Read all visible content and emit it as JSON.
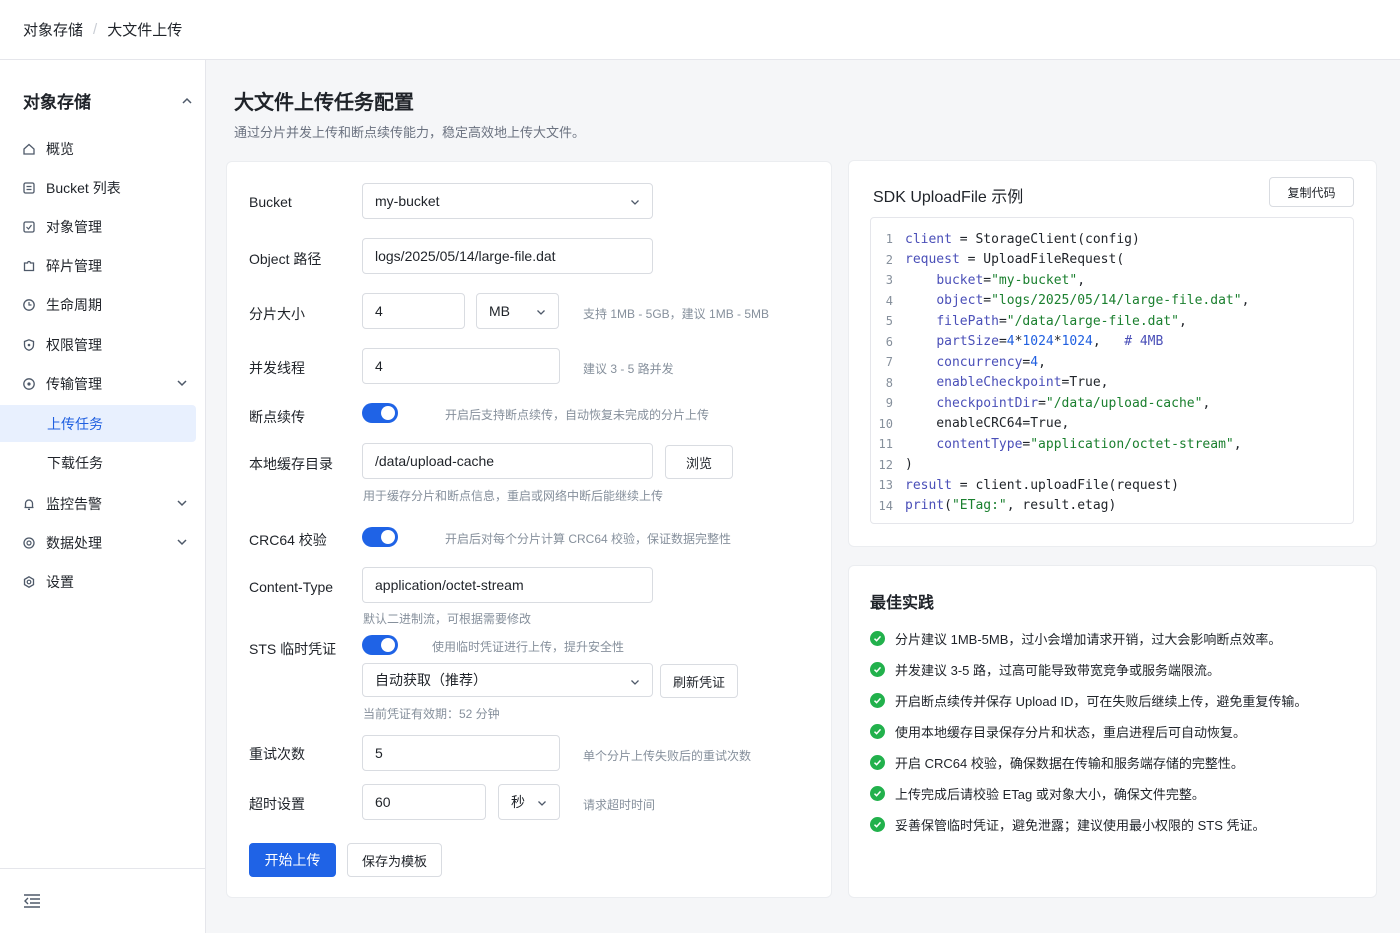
{
  "breadcrumb": {
    "root": "对象存储",
    "current": "大文件上传"
  },
  "sidebar": {
    "header": "对象存储",
    "items": [
      {
        "label": "概览",
        "icon": "home-icon"
      },
      {
        "label": "Bucket 列表",
        "icon": "list-icon"
      },
      {
        "label": "对象管理",
        "icon": "file-icon"
      },
      {
        "label": "碎片管理",
        "icon": "puzzle-icon"
      },
      {
        "label": "生命周期",
        "icon": "clock-icon"
      },
      {
        "label": "权限管理",
        "icon": "shield-icon"
      },
      {
        "label": "传输管理",
        "icon": "transfer-icon"
      },
      {
        "label": "上传任务"
      },
      {
        "label": "下载任务"
      },
      {
        "label": "监控告警",
        "icon": "bell-icon"
      },
      {
        "label": "数据处理",
        "icon": "gear-icon"
      },
      {
        "label": "设置",
        "icon": "settings-icon"
      }
    ]
  },
  "page": {
    "title": "大文件上传任务配置",
    "description": "通过分片并发上传和断点续传能力，稳定高效地上传大文件。"
  },
  "form": {
    "bucket_label": "Bucket",
    "bucket_value": "my-bucket",
    "path_label": "Object 路径",
    "path_value": "logs/2025/05/14/large-file.dat",
    "part_label": "分片大小",
    "part_value": "4",
    "part_unit": "MB",
    "part_hint": "支持 1MB - 5GB，建议 1MB - 5MB",
    "threads_label": "并发线程",
    "threads_value": "4",
    "threads_hint": "建议 3 - 5 路并发",
    "resume_label": "断点续传",
    "resume_hint": "开启后支持断点续传，自动恢复未完成的分片上传",
    "cache_label": "本地缓存目录",
    "cache_value": "/data/upload-cache",
    "browse_button": "浏览",
    "cache_hint": "用于缓存分片和断点信息，重启或网络中断后能继续上传",
    "crc_label": "CRC64 校验",
    "crc_hint": "开启后对每个分片计算 CRC64 校验，保证数据完整性",
    "ctype_label": "Content-Type",
    "ctype_value": "application/octet-stream",
    "ctype_hint": "默认二进制流，可根据需要修改",
    "sts_label": "STS 临时凭证",
    "sts_hint": "使用临时凭证进行上传，提升安全性",
    "sts_mode": "自动获取（推荐）",
    "refresh_button": "刷新凭证",
    "sts_valid": "当前凭证有效期：52 分钟",
    "retry_label": "重试次数",
    "retry_value": "5",
    "retry_hint": "单个分片上传失败后的重试次数",
    "timeout_label": "超时设置",
    "timeout_value": "60",
    "timeout_unit": "秒",
    "timeout_hint": "请求超时时间",
    "start_button": "开始上传",
    "save_button": "保存为模板"
  },
  "sdk": {
    "title": "SDK UploadFile 示例",
    "copy_button": "复制代码",
    "lines": [
      {
        "n": "1",
        "text": "client = StorageClient(config)"
      },
      {
        "n": "2",
        "text": "request = UploadFileRequest("
      },
      {
        "n": "3",
        "text": "    bucket=\"my-bucket\","
      },
      {
        "n": "4",
        "text": "    object=\"logs/2025/05/14/large-file.dat\","
      },
      {
        "n": "5",
        "text": "    filePath=\"/data/large-file.dat\","
      },
      {
        "n": "6",
        "text": "    partSize=4*1024*1024,   # 4MB"
      },
      {
        "n": "7",
        "text": "    concurrency=4,"
      },
      {
        "n": "8",
        "text": "    enableCheckpoint=True,"
      },
      {
        "n": "9",
        "text": "    checkpointDir=\"/data/upload-cache\","
      },
      {
        "n": "10",
        "text": "    enableCRC64=True,"
      },
      {
        "n": "11",
        "text": "    contentType=\"application/octet-stream\","
      },
      {
        "n": "12",
        "text": ")"
      },
      {
        "n": "13",
        "text": "result = client.uploadFile(request)"
      },
      {
        "n": "14",
        "text": "print(\"ETag:\", result.etag)"
      }
    ]
  },
  "best": {
    "title": "最佳实践",
    "items": [
      "分片建议 1MB-5MB，过小会增加请求开销，过大会影响断点效率。",
      "并发建议 3-5 路，过高可能导致带宽竞争或服务端限流。",
      "开启断点续传并保存 Upload ID，可在失败后继续上传，避免重复传输。",
      "使用本地缓存目录保存分片和状态，重启进程后可自动恢复。",
      "开启 CRC64 校验，确保数据在传输和服务端存储的完整性。",
      "上传完成后请校验 ETag 或对象大小，确保文件完整。",
      "妥善保管临时凭证，避免泄露；建议使用最小权限的 STS 凭证。"
    ]
  },
  "colors": {
    "primary": "#1f63e6",
    "success": "#22b14c"
  }
}
